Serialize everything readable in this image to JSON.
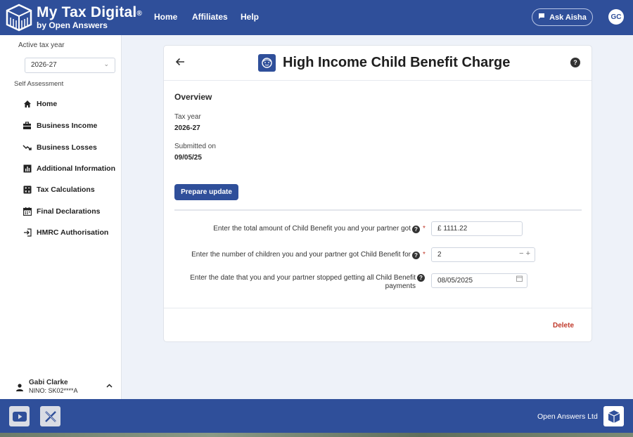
{
  "header": {
    "brand_title": "My Tax Digital",
    "brand_mark": "®",
    "brand_sub": "by Open Answers",
    "nav": [
      "Home",
      "Affiliates",
      "Help"
    ],
    "ask_label": "Ask Aisha",
    "avatar_initials": "GC"
  },
  "sidebar": {
    "active_year_label": "Active tax year",
    "selected_year": "2026-27",
    "section_label": "Self Assessment",
    "items": [
      {
        "label": "Home",
        "icon": "home-icon"
      },
      {
        "label": "Business Income",
        "icon": "briefcase-icon"
      },
      {
        "label": "Business Losses",
        "icon": "trend-down-icon"
      },
      {
        "label": "Additional Information",
        "icon": "bar-chart-icon"
      },
      {
        "label": "Tax Calculations",
        "icon": "calculator-icon"
      },
      {
        "label": "Final Declarations",
        "icon": "calendar-icon"
      },
      {
        "label": "HMRC Authorisation",
        "icon": "login-icon"
      }
    ],
    "user_name": "Gabi Clarke",
    "user_nino": "NINO: SK02****A"
  },
  "card": {
    "title": "High Income Child Benefit Charge",
    "overview_heading": "Overview",
    "tax_year_label": "Tax year",
    "tax_year_value": "2026-27",
    "submitted_label": "Submitted on",
    "submitted_value": "09/05/25",
    "prepare_label": "Prepare update",
    "questions": [
      {
        "text": "Enter the total amount of Child Benefit you and your partner got",
        "required": true,
        "value": "£ 1111.22"
      },
      {
        "text": "Enter the number of children you and your partner got Child Benefit for",
        "required": true,
        "value": "2"
      },
      {
        "text_line1": "Enter the date that you and your partner stopped getting all Child Benefit",
        "text_line2": "payments",
        "required": false,
        "value": "08/05/2025"
      }
    ],
    "required_mark": "*",
    "delete_label": "Delete"
  },
  "footer": {
    "company": "Open Answers Ltd"
  },
  "colors": {
    "primary": "#2f4f9a",
    "danger": "#c0392b",
    "background": "#eef2f9"
  }
}
